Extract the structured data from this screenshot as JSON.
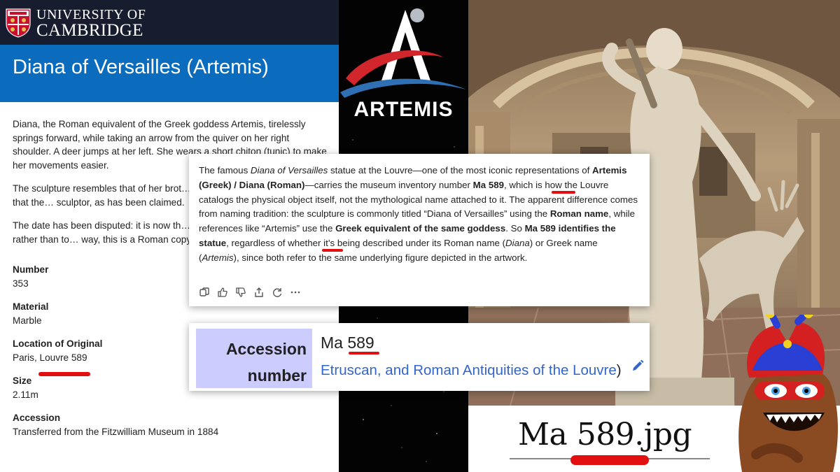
{
  "cambridge": {
    "logo_line1": "UNIVERSITY OF",
    "logo_line2": "CAMBRIDGE",
    "title": "Diana of Versailles (Artemis)",
    "para1": "Diana, the Roman equivalent of the Greek goddess Artemis, tirelessly springs forward, while taking an arrow from the quiver on her right shoulder. A deer jumps at her left. She wears a short chiton (tunic) to make her movements easier.",
    "para2": "The sculpture resembles that of her brot… However there is little evidence that the… sculptor, as has been claimed.",
    "para3": "The date has been disputed: it is now th… dated to around 100 BCE rather than to… way, this is a Roman copy",
    "fields": [
      {
        "label": "Number",
        "value": "353"
      },
      {
        "label": "Material",
        "value": "Marble"
      },
      {
        "label": "Location of Original",
        "value": "Paris, Louvre 589"
      },
      {
        "label": "Size",
        "value": "2.11m"
      },
      {
        "label": "Accession",
        "value": "Transferred from the Fitzwilliam Museum in 1884"
      }
    ]
  },
  "artemis_logo": {
    "word": "ARTEMIS"
  },
  "chat": {
    "t1": "The famous ",
    "t2": "Diana of Versailles",
    "t3": " statue at the Louvre—one of the most iconic representations of ",
    "t4": "Artemis (Greek) / Diana (Roman)",
    "t5": "—carries the museum inventory number ",
    "t6": "Ma 589",
    "t7": ", which is how the Louvre catalogs the physical object itself, not the mythological name attached to it. The apparent difference comes from naming tradition: the sculpture is commonly titled “Diana of Versailles” using the ",
    "t8": "Roman name",
    "t9": ", while references like “Artemis” use the ",
    "t10": "Greek equivalent of the same goddess",
    "t11": ". So ",
    "t12": "Ma 589 identifies the statue",
    "t13": ", regardless of whether it’s being described under its Roman name (",
    "t14": "Diana",
    "t15": ") or Greek name (",
    "t16": "Artemis",
    "t17": "), since both refer to the same underlying figure depicted in the artwork.",
    "actions": [
      "copy-icon",
      "thumbs-up-icon",
      "thumbs-down-icon",
      "share-icon",
      "regenerate-icon",
      "more-icon"
    ]
  },
  "accession": {
    "label_line1": "Accession",
    "label_line2": "number",
    "value": "Ma 589",
    "link": "Etruscan, and Roman Antiquities of the Louvre",
    "paren": ")"
  },
  "filename": "Ma 589.jpg",
  "colors": {
    "cambridge_header": "#171d2f",
    "cambridge_band": "#0b6bbd",
    "highlight_red": "#e10f0f",
    "wiki_label_bg": "#ccccff",
    "wiki_link": "#3366cc"
  }
}
